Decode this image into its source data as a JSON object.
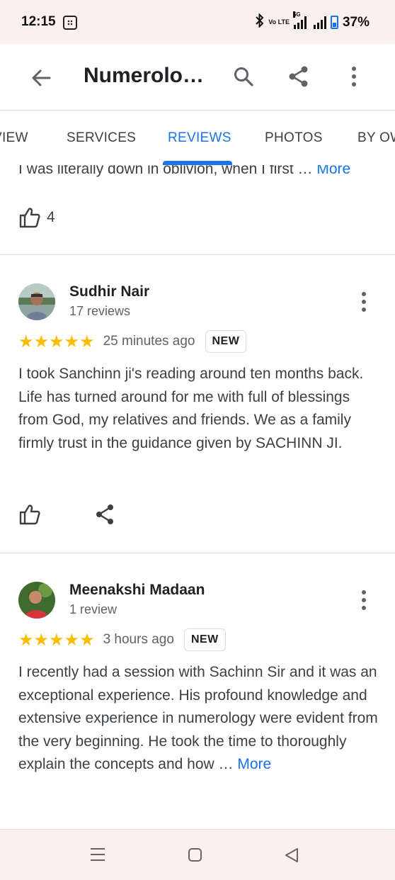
{
  "status_bar": {
    "time": "12:15",
    "network_label": "5G",
    "volte_label": "Vo LTE",
    "battery_percent": "37%"
  },
  "app_bar": {
    "title": "Numerolo…",
    "icons": [
      "back-arrow-icon",
      "search-icon",
      "share-icon",
      "more-vert-icon"
    ]
  },
  "tabs": [
    {
      "label": "VIEW",
      "active": false
    },
    {
      "label": "SERVICES",
      "active": false
    },
    {
      "label": "REVIEWS",
      "active": true
    },
    {
      "label": "PHOTOS",
      "active": false
    },
    {
      "label": "BY OW",
      "active": false
    }
  ],
  "previous_review": {
    "text_snippet": "I was literally down in oblivion, when I first …",
    "more_label": "More",
    "likes": "4"
  },
  "reviews": [
    {
      "name": "Sudhir Nair",
      "review_count": "17 reviews",
      "stars": "★★★★★",
      "rating": 5,
      "time": "25 minutes ago",
      "badge": "NEW",
      "text": "I took Sanchinn ji's reading around ten months back. Life has turned around for me with full of blessings from God, my relatives and friends. We as a family firmly trust in the guidance given by SACHINN JI."
    },
    {
      "name": "Meenakshi Madaan",
      "review_count": "1 review",
      "stars": "★★★★★",
      "rating": 5,
      "time": "3 hours ago",
      "badge": "NEW",
      "text": "I recently had a session with Sachinn Sir and it was an exceptional experience. His profound knowledge and extensive experience in numerology were evident from the very beginning. He took the time to thoroughly explain the concepts and how …",
      "more_label": "More"
    }
  ],
  "colors": {
    "accent": "#1a73e8",
    "star": "#fbbc04",
    "status_bar_bg": "#fbf0f0"
  }
}
